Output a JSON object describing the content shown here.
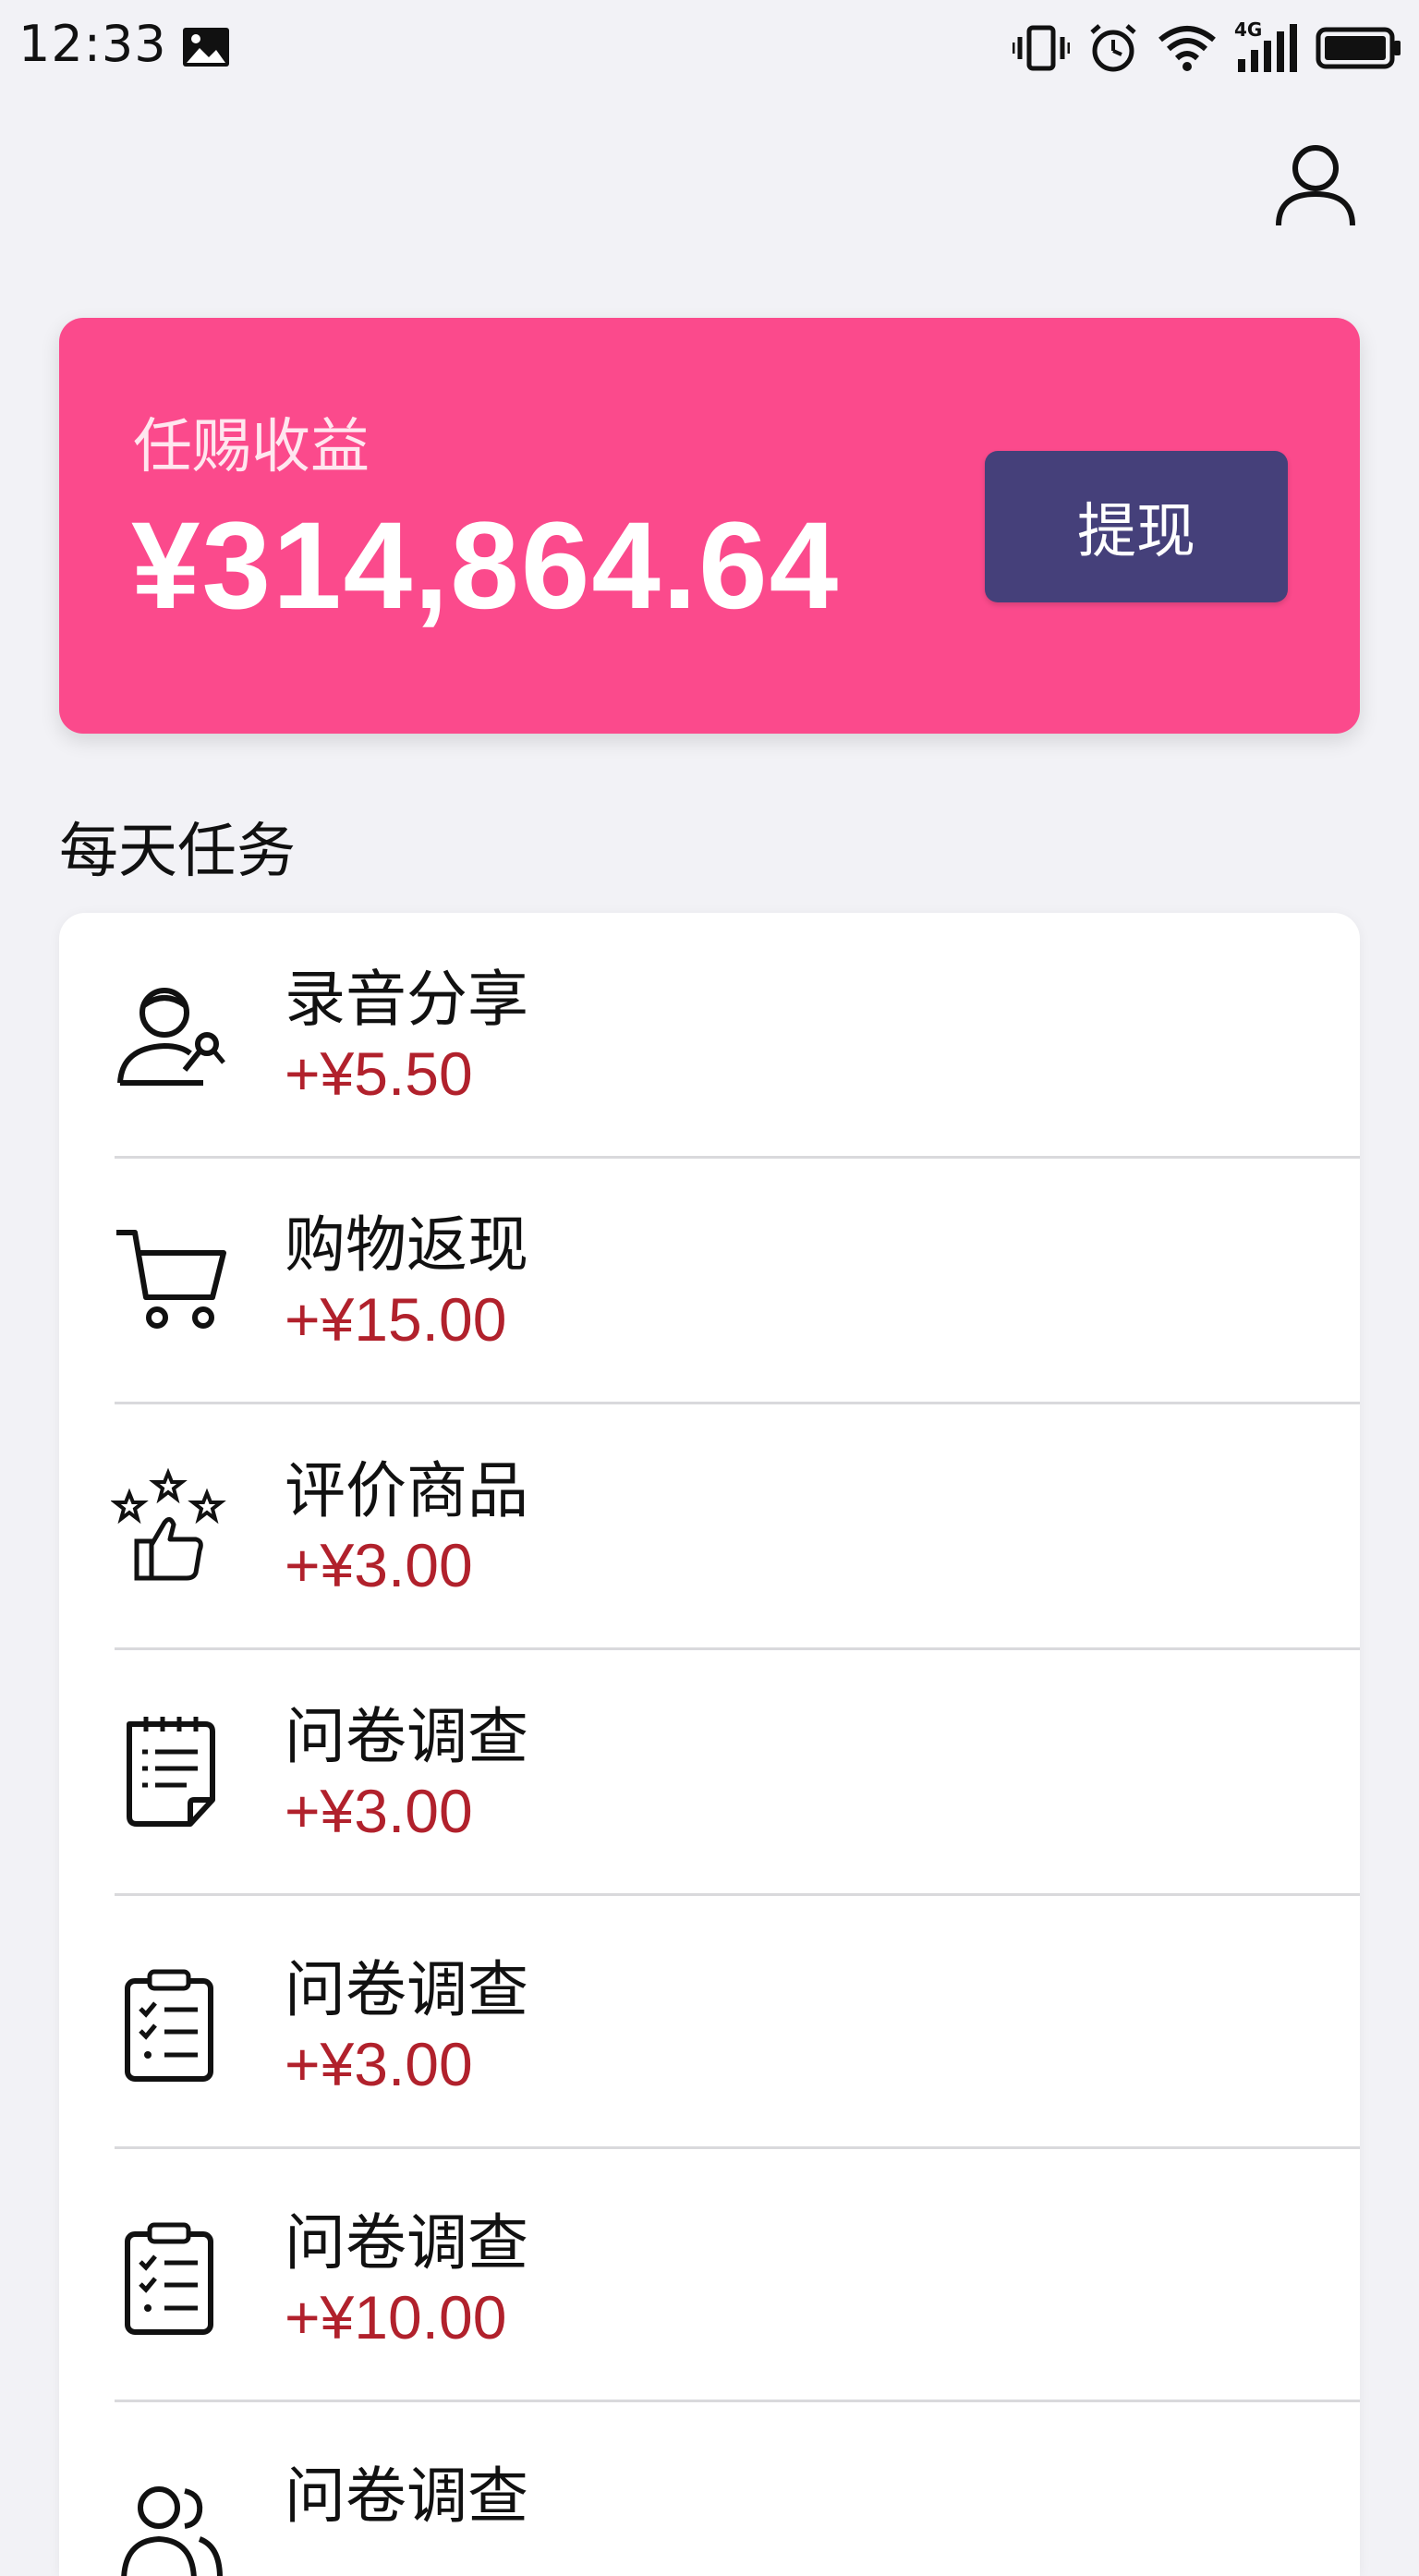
{
  "status_bar": {
    "time": "12:33",
    "network_label": "4G"
  },
  "earnings": {
    "label": "任赐收益",
    "amount": "¥314,864.64",
    "withdraw_label": "提现",
    "card_color": "#fb4a8c",
    "button_color": "#45407a"
  },
  "section": {
    "title": "每天任务"
  },
  "tasks": [
    {
      "title": "录音分享",
      "reward": "+¥5.50",
      "icon": "person-microphone-icon"
    },
    {
      "title": "购物返现",
      "reward": "+¥15.00",
      "icon": "shopping-cart-icon"
    },
    {
      "title": "评价商品",
      "reward": "+¥3.00",
      "icon": "thumbs-up-stars-icon"
    },
    {
      "title": "问卷调查",
      "reward": "+¥3.00",
      "icon": "notepad-icon"
    },
    {
      "title": "问卷调查",
      "reward": "+¥3.00",
      "icon": "clipboard-checklist-icon"
    },
    {
      "title": "问卷调查",
      "reward": "+¥10.00",
      "icon": "clipboard-checklist-icon"
    },
    {
      "title": "问卷调查",
      "reward": "",
      "icon": "users-icon"
    }
  ],
  "colors": {
    "reward_text": "#b1212c",
    "background": "#f2f2f6"
  }
}
